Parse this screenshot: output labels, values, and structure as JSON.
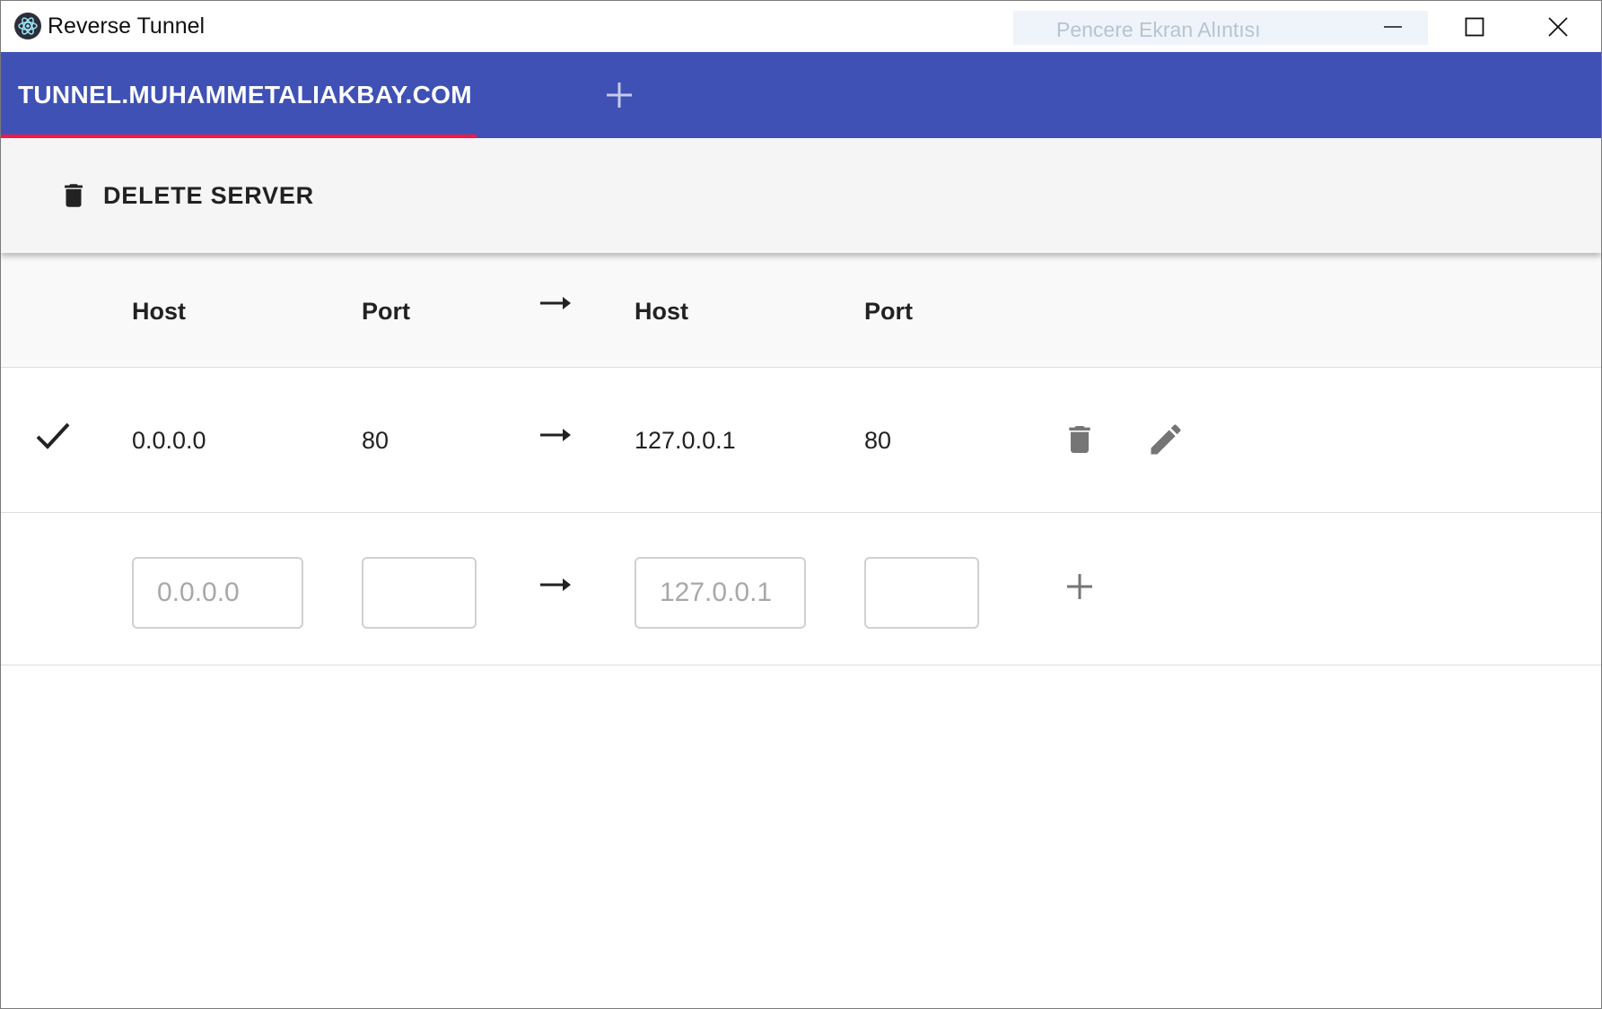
{
  "window": {
    "title": "Reverse Tunnel",
    "snipping_overlay_label": "Pencere Ekran Alıntısı"
  },
  "tabs": [
    {
      "label": "TUNNEL.MUHAMMETALIAKBAY.COM",
      "selected": true
    }
  ],
  "toolbar": {
    "delete_server_label": "DELETE SERVER"
  },
  "table": {
    "headers": {
      "remote_host": "Host",
      "remote_port": "Port",
      "local_host": "Host",
      "local_port": "Port"
    },
    "rows": [
      {
        "active": true,
        "remote_host": "0.0.0.0",
        "remote_port": "80",
        "local_host": "127.0.0.1",
        "local_port": "80"
      }
    ],
    "new_row": {
      "remote_host_placeholder": "0.0.0.0",
      "remote_port_placeholder": "",
      "local_host_placeholder": "127.0.0.1",
      "local_port_placeholder": ""
    }
  },
  "colors": {
    "appbar": "#3f51b5",
    "tab_indicator": "#ff1744",
    "toolbar_bg": "#f5f5f5",
    "icon_grey": "#757575"
  },
  "icons": {
    "app": "electron-atom-icon",
    "add_tab": "plus-icon",
    "delete_server": "trash-icon",
    "direction": "arrow-right-icon",
    "active": "check-icon",
    "row_delete": "trash-icon",
    "row_edit": "pencil-icon",
    "row_add": "plus-icon"
  }
}
